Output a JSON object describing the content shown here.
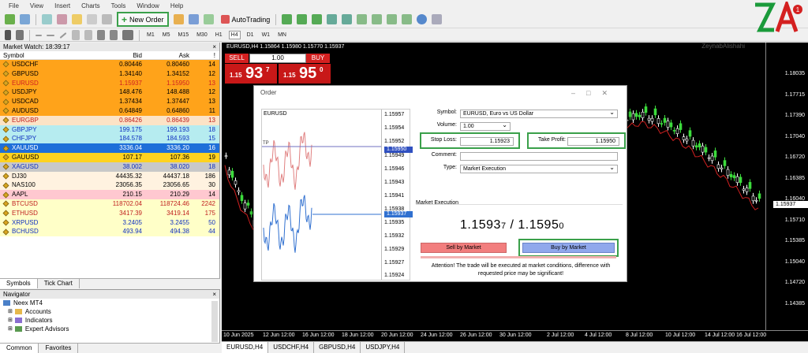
{
  "menu": [
    "File",
    "View",
    "Insert",
    "Charts",
    "Tools",
    "Window",
    "Help"
  ],
  "toolbar": {
    "new_order": "New Order",
    "autotrading": "AutoTrading"
  },
  "timeframes": [
    "M1",
    "M5",
    "M15",
    "M30",
    "H1",
    "H4",
    "D1",
    "W1",
    "MN"
  ],
  "market_watch": {
    "title": "Market Watch: 18:39:17",
    "close": "×",
    "headers": {
      "symbol": "Symbol",
      "bid": "Bid",
      "ask": "Ask",
      "spread": "!"
    },
    "rows": [
      {
        "symbol": "USDCHF",
        "bid": "0.80446",
        "ask": "0.80460",
        "spread": "14",
        "bg": "#ffa31a",
        "color": "#000"
      },
      {
        "symbol": "GBPUSD",
        "bid": "1.34140",
        "ask": "1.34152",
        "spread": "12",
        "bg": "#ffa31a",
        "color": "#000"
      },
      {
        "symbol": "EURUSD",
        "bid": "1.15937",
        "ask": "1.15950",
        "spread": "13",
        "bg": "#ffa31a",
        "color": "#d02020"
      },
      {
        "symbol": "USDJPY",
        "bid": "148.476",
        "ask": "148.488",
        "spread": "12",
        "bg": "#ffa31a",
        "color": "#000"
      },
      {
        "symbol": "USDCAD",
        "bid": "1.37434",
        "ask": "1.37447",
        "spread": "13",
        "bg": "#ffa31a",
        "color": "#000"
      },
      {
        "symbol": "AUDUSD",
        "bid": "0.64849",
        "ask": "0.64860",
        "spread": "11",
        "bg": "#ffa31a",
        "color": "#000"
      },
      {
        "symbol": "EURGBP",
        "bid": "0.86426",
        "ask": "0.86439",
        "spread": "13",
        "bg": "#fce3c6",
        "color": "#c02020"
      },
      {
        "symbol": "GBPJPY",
        "bid": "199.175",
        "ask": "199.193",
        "spread": "18",
        "bg": "#b6ecf0",
        "color": "#1030c0"
      },
      {
        "symbol": "CHFJPY",
        "bid": "184.578",
        "ask": "184.593",
        "spread": "15",
        "bg": "#b6ecf0",
        "color": "#1030c0"
      },
      {
        "symbol": "XAUUSD",
        "bid": "3336.04",
        "ask": "3336.20",
        "spread": "16",
        "bg": "#1e6fd9",
        "color": "#fff"
      },
      {
        "symbol": "GAUUSD",
        "bid": "107.17",
        "ask": "107.36",
        "spread": "19",
        "bg": "#ffd21f",
        "color": "#000"
      },
      {
        "symbol": "XAGUSD",
        "bid": "38.002",
        "ask": "38.020",
        "spread": "18",
        "bg": "#c8c8c8",
        "color": "#1030c0"
      },
      {
        "symbol": "DJ30",
        "bid": "44435.32",
        "ask": "44437.18",
        "spread": "186",
        "bg": "#fff2e0",
        "color": "#000"
      },
      {
        "symbol": "NAS100",
        "bid": "23056.35",
        "ask": "23056.65",
        "spread": "30",
        "bg": "#fff2e0",
        "color": "#000"
      },
      {
        "symbol": "AAPL",
        "bid": "210.15",
        "ask": "210.29",
        "spread": "14",
        "bg": "#ffc8d0",
        "color": "#000"
      },
      {
        "symbol": "BTCUSD",
        "bid": "118702.04",
        "ask": "118724.46",
        "spread": "2242",
        "bg": "#ffffc8",
        "color": "#c02020"
      },
      {
        "symbol": "ETHUSD",
        "bid": "3417.39",
        "ask": "3419.14",
        "spread": "175",
        "bg": "#ffffc8",
        "color": "#c02020"
      },
      {
        "symbol": "XRPUSD",
        "bid": "3.2405",
        "ask": "3.2455",
        "spread": "50",
        "bg": "#ffffc8",
        "color": "#1030c0"
      },
      {
        "symbol": "BCHUSD",
        "bid": "493.94",
        "ask": "494.38",
        "spread": "44",
        "bg": "#ffffc8",
        "color": "#1030c0"
      }
    ],
    "tabs": [
      "Symbols",
      "Tick Chart"
    ]
  },
  "navigator": {
    "title": "Navigator",
    "close": "×",
    "root": "Neex MT4",
    "items": [
      "Accounts",
      "Indicators",
      "Expert Advisors"
    ],
    "tabs": [
      "Common",
      "Favorites"
    ]
  },
  "chart": {
    "info": "EURUSD,H4  1.15864 1.15980 1.15770 1.15937",
    "watermark": "ZeynabAlishahi",
    "sell": "SELL",
    "buy": "BUY",
    "lot": "1.00",
    "sell_small": "1.15",
    "sell_big": "93",
    "sell_sup": "7",
    "buy_small": "1.15",
    "buy_big": "95",
    "buy_sup": "0",
    "y_ticks": [
      "1.18035",
      "1.17715",
      "1.17390",
      "1.17040",
      "1.16720",
      "1.16385",
      "1.16040",
      "1.15710",
      "1.15385",
      "1.15040",
      "1.14720",
      "1.14385"
    ],
    "price_marker": "1.15937",
    "x_ticks": [
      "10 Jun 2025",
      "12 Jun 12:00",
      "16 Jun 12:00",
      "18 Jun 12:00",
      "20 Jun 12:00",
      "24 Jun 12:00",
      "26 Jun 12:00",
      "30 Jun 12:00",
      "2 Jul 12:00",
      "4 Jul 12:00",
      "8 Jul 12:00",
      "10 Jul 12:00",
      "14 Jul 12:00",
      "16 Jul 12:00"
    ],
    "tabs": [
      "EURUSD,H4",
      "USDCHF,H4",
      "GBPUSD,H4",
      "USDJPY,H4"
    ]
  },
  "order": {
    "title": "Order",
    "mini_symbol": "EURUSD",
    "mini_y": [
      "1.15957",
      "1.15954",
      "1.15952",
      "1.15949",
      "1.15946",
      "1.15943",
      "1.15941",
      "1.15938",
      "1.15935",
      "1.15932",
      "1.15929",
      "1.15927",
      "1.15924"
    ],
    "mini_ask": "1.15950",
    "mini_bid": "1.15937",
    "mini_tp": "TP",
    "symbol_label": "Symbol:",
    "symbol_value": "EURUSD, Euro vs US Dollar",
    "volume_label": "Volume:",
    "volume_value": "1.00",
    "sl_label": "Stop Loss:",
    "sl_value": "1.15923",
    "tp_label": "Take Profit:",
    "tp_value": "1.15950",
    "comment_label": "Comment:",
    "comment_value": "",
    "type_label": "Type:",
    "type_value": "Market Execution",
    "market_exec": "Market Execution",
    "bid_main": "1.1593",
    "bid_sub": "7",
    "slash": " / ",
    "ask_main": "1.1595",
    "ask_sub": "0",
    "sell_by_market": "Sell by Market",
    "buy_by_market": "Buy by Market",
    "attention": "Attention! The trade will be executed at market conditions, difference with requested price may be significant!"
  },
  "colors": {
    "highlight": "#3aa04a",
    "buy_button": "#90a8ec",
    "sell_button": "#f27e7e",
    "bull": "#3ddc3d",
    "bear": "#ffffff",
    "ma": "#d02020"
  }
}
